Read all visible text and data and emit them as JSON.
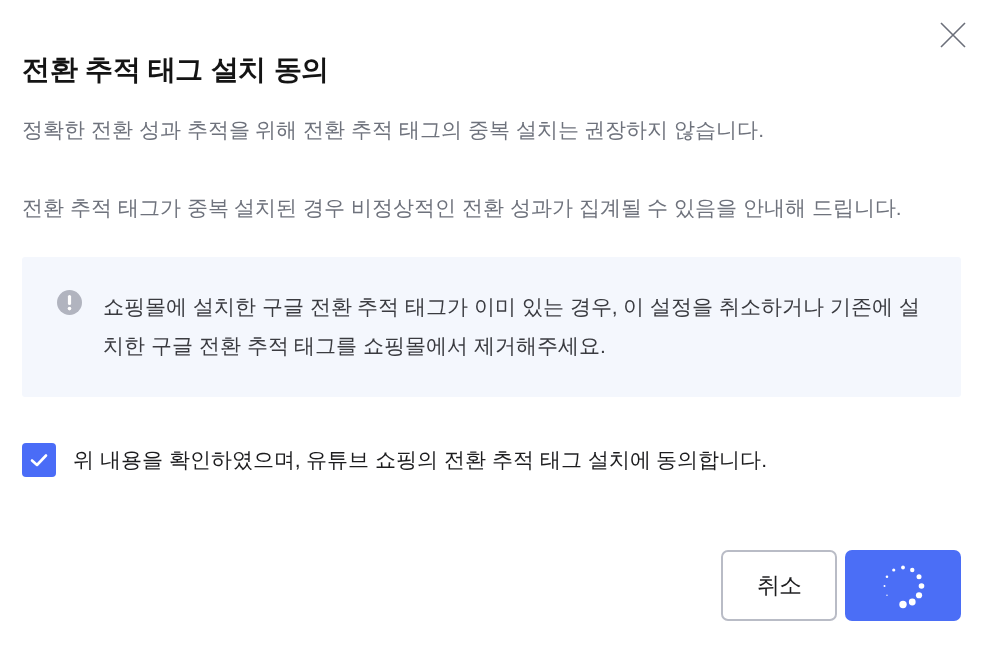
{
  "dialog": {
    "title": "전환 추적 태그 설치 동의",
    "paragraphs": [
      "정확한 전환 성과 추적을 위해 전환 추적 태그의 중복 설치는 권장하지 않습니다.",
      "전환 추적 태그가 중복 설치된 경우 비정상적인 전환 성과가 집계될 수 있음을 안내해 드립니다."
    ],
    "notice": {
      "text": "쇼핑몰에 설치한 구글 전환 추적 태그가 이미 있는 경우, 이 설정을 취소하거나 기존에 설치한 구글 전환 추적 태그를 쇼핑몰에서 제거해주세요."
    },
    "agreement": {
      "label": "위 내용을 확인하였으며, 유튜브 쇼핑의 전환 추적 태그 설치에 동의합니다.",
      "checked": true
    },
    "buttons": [
      {
        "kind": "outline",
        "label": "취소",
        "loading": false
      },
      {
        "kind": "filled",
        "loading": true
      }
    ]
  }
}
